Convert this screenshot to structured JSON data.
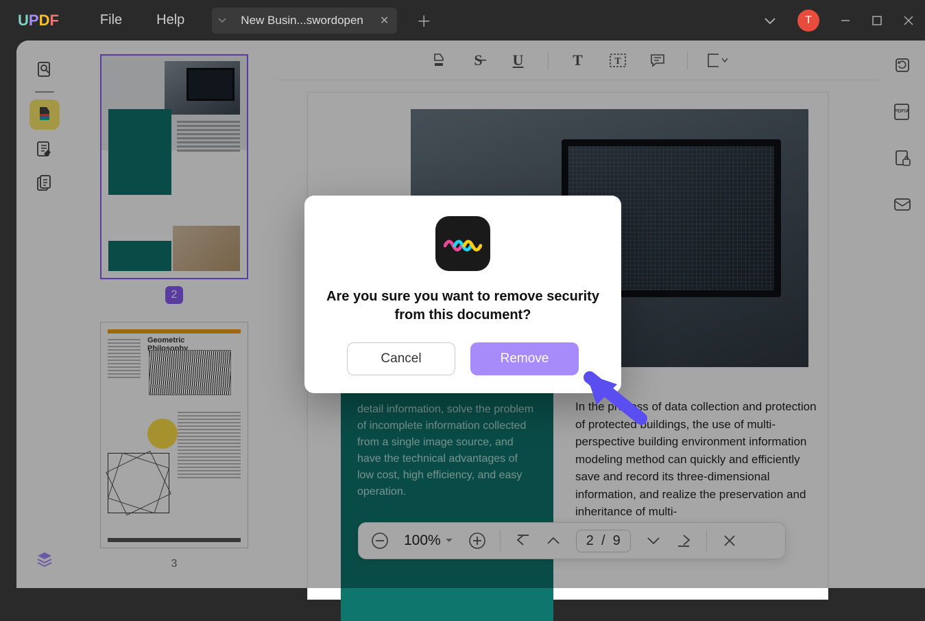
{
  "menu": {
    "file": "File",
    "help": "Help"
  },
  "tab": {
    "title": "New Busin...swordopen"
  },
  "avatar": {
    "initial": "T"
  },
  "thumbnails": {
    "page2": "2",
    "page3": "3",
    "thumb3_heading": "Geometric\nPhilosophy"
  },
  "zoom": {
    "level": "100%"
  },
  "pager": {
    "current": "2",
    "sep": "/",
    "total": "9"
  },
  "doc": {
    "teal_text": "detail information, solve the problem of incomplete information collected from a single image source, and have the technical advantages of low cost, high efficiency, and easy operation.",
    "right_text": "In the process of data collection and protection of protected buildings, the use of multi-perspective building environment information modeling method can quickly and efficiently save and record its three-dimensional information, and realize the preservation and inheritance of multi-"
  },
  "modal": {
    "message": "Are you sure you want to remove security from this document?",
    "cancel": "Cancel",
    "remove": "Remove"
  }
}
